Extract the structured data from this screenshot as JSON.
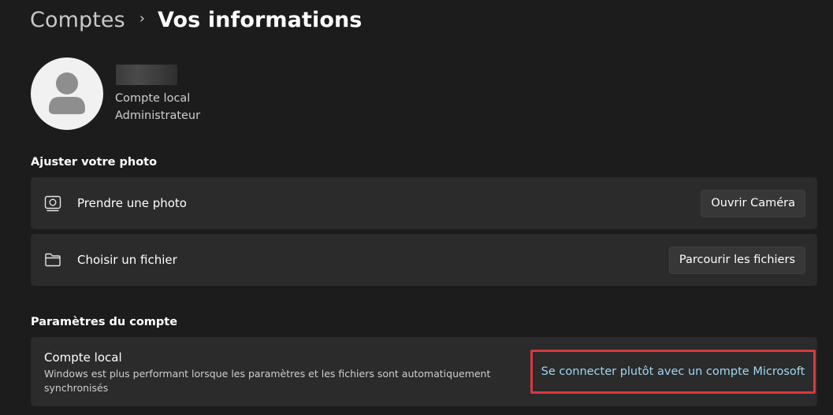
{
  "breadcrumb": {
    "parent": "Comptes",
    "separator": "›",
    "current": "Vos informations"
  },
  "profile": {
    "account_type": "Compte local",
    "role": "Administrateur"
  },
  "photo_section": {
    "title": "Ajuster votre photo",
    "items": [
      {
        "label": "Prendre une photo",
        "button": "Ouvrir Caméra",
        "icon": "camera-icon"
      },
      {
        "label": "Choisir un fichier",
        "button": "Parcourir les fichiers",
        "icon": "folder-icon"
      }
    ]
  },
  "account_section": {
    "title": "Paramètres du compte",
    "card_title": "Compte local",
    "card_description": "Windows est plus performant lorsque les paramètres et les fichiers sont automatiquement synchronisés",
    "link": "Se connecter plutôt avec un compte Microsoft"
  },
  "colors": {
    "background": "#1c1c1c",
    "card": "#2b2b2b",
    "link": "#9fd8f4",
    "highlight": "#d8393f"
  }
}
